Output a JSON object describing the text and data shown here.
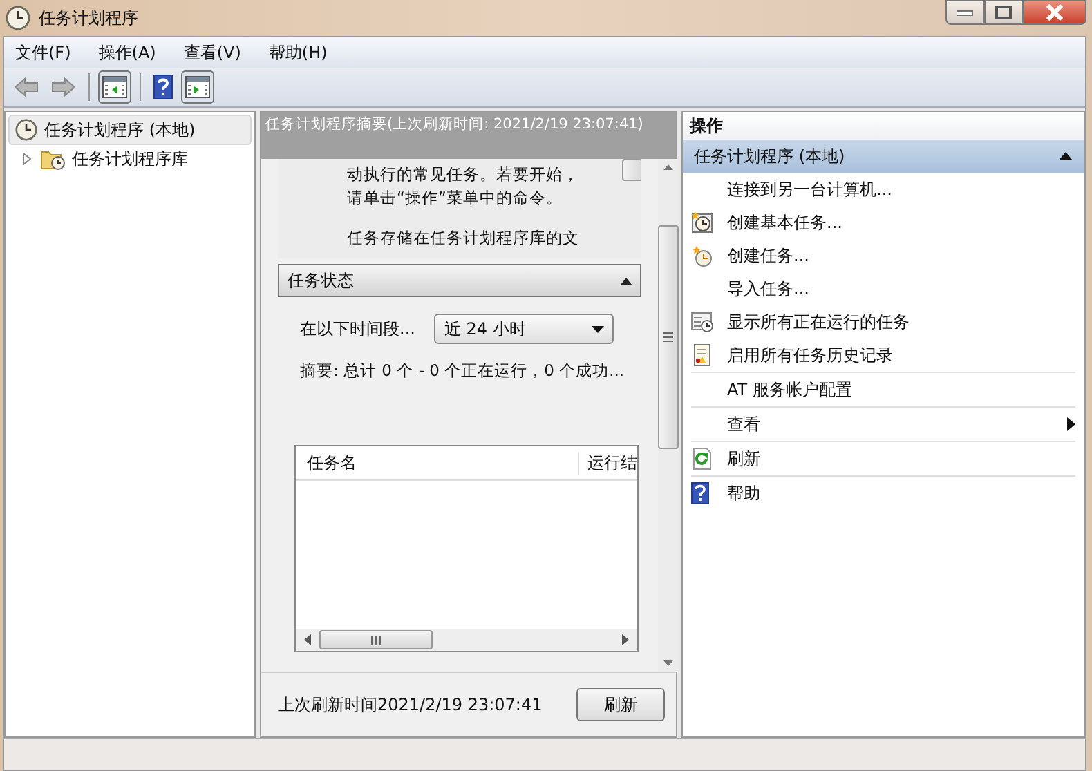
{
  "window": {
    "title": "任务计划程序"
  },
  "menu": [
    "文件(F)",
    "操作(A)",
    "查看(V)",
    "帮助(H)"
  ],
  "toolbar": [
    {
      "kind": "back",
      "disabled": true
    },
    {
      "kind": "forward",
      "disabled": true
    },
    {
      "kind": "tree-pane",
      "pressed": true
    },
    {
      "kind": "help",
      "pressed": false
    },
    {
      "kind": "action-pane",
      "pressed": true
    }
  ],
  "tree": [
    {
      "label": "任务计划程序 (本地)",
      "selected": true,
      "children": [
        {
          "label": "任务计划程序库",
          "selected": false,
          "expanded": false
        }
      ]
    }
  ],
  "summary": {
    "header": "任务计划程序摘要(上次刷新时间: 2021/2/19 23:07:41)",
    "description": [
      [
        "动执行的常见任务。若要开始，",
        "请单击“操作”菜单中的命令。"
      ],
      [
        "任务存储在任务计划程序库的文"
      ]
    ],
    "status_panel": {
      "title": "任务状态",
      "expanded": true,
      "period_label": "在以下时间段...",
      "period_value": "近 24 小时",
      "summary_text": "摘要: 总计 0 个 - 0 个正在运行，0 个成功...",
      "table": {
        "columns": [
          "任务名",
          "运行结"
        ]
      }
    },
    "last_refresh": "上次刷新时间2021/2/19 23:07:41",
    "refresh_button": "刷新"
  },
  "actions": {
    "title": "操作",
    "section": {
      "title": "任务计划程序 (本地)",
      "expanded": true
    },
    "items": [
      {
        "label": "连接到另一台计算机...",
        "kind": "none",
        "divider": false,
        "submenu": false
      },
      {
        "label": "创建基本任务...",
        "kind": "clock-star",
        "divider": false,
        "submenu": false
      },
      {
        "label": "创建任务...",
        "kind": "clock-new",
        "divider": false,
        "submenu": false
      },
      {
        "label": "导入任务...",
        "kind": "none",
        "divider": false,
        "submenu": false
      },
      {
        "label": "显示所有正在运行的任务",
        "kind": "list-clock",
        "divider": false,
        "submenu": false
      },
      {
        "label": "启用所有任务历史记录",
        "kind": "log",
        "divider": false,
        "submenu": false
      },
      {
        "label": "AT 服务帐户配置",
        "kind": "none",
        "divider": true,
        "submenu": false
      },
      {
        "label": "查看",
        "kind": "none",
        "divider": true,
        "submenu": true
      },
      {
        "label": "刷新",
        "kind": "refresh",
        "divider": true,
        "submenu": false
      },
      {
        "label": "帮助",
        "kind": "help",
        "divider": true,
        "submenu": false
      }
    ]
  }
}
